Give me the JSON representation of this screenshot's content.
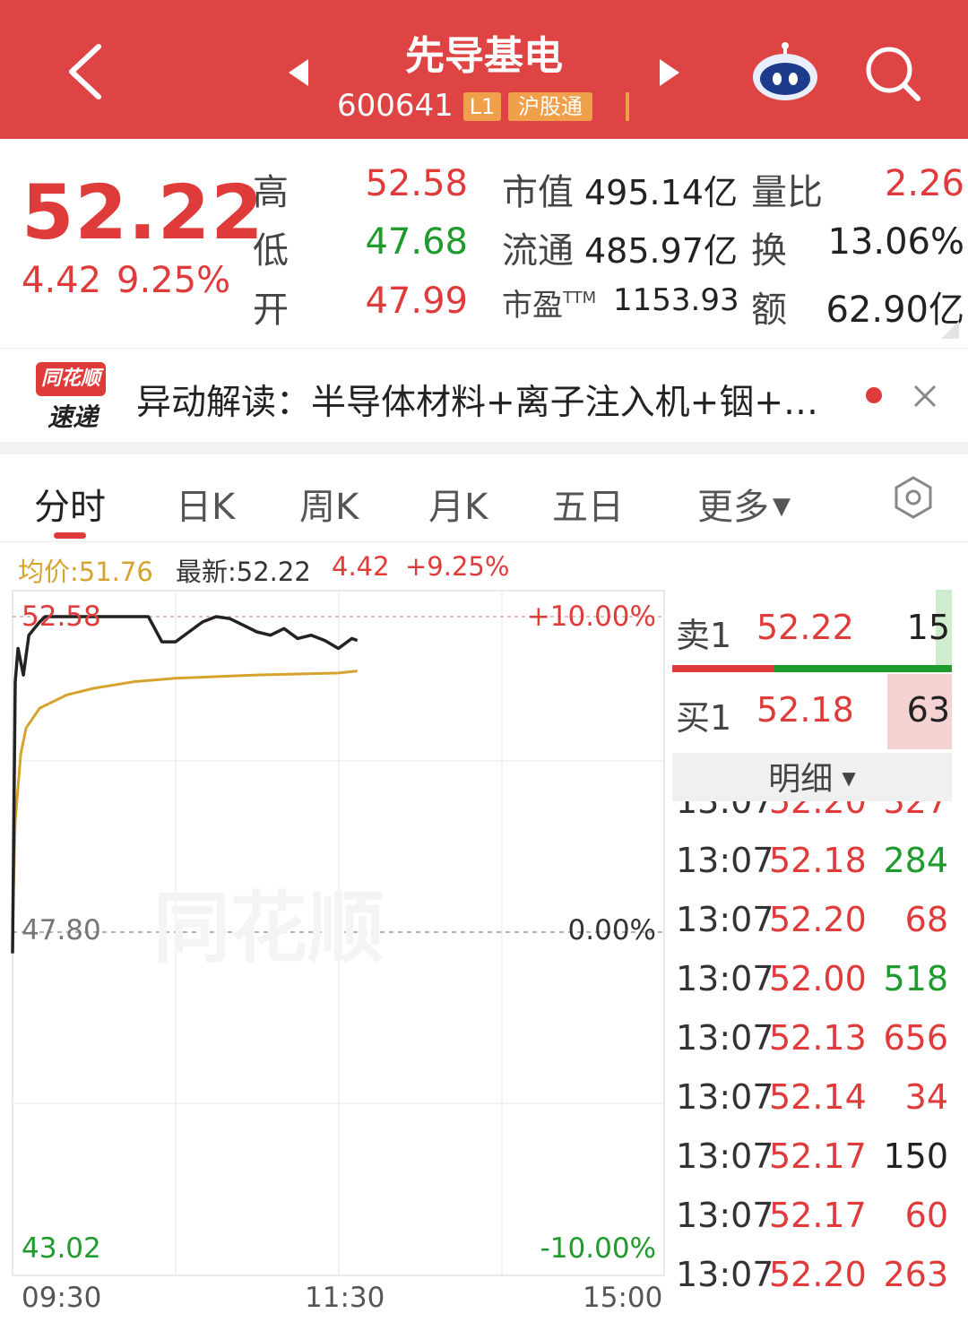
{
  "header": {
    "title": "先导基电",
    "code": "600641",
    "tag_l1": "L1",
    "tag_connect": "沪股通"
  },
  "quote": {
    "price": "52.22",
    "change": "4.42",
    "change_pct": "9.25%",
    "high_label": "高",
    "high": "52.58",
    "low_label": "低",
    "low": "47.68",
    "open_label": "开",
    "open": "47.99",
    "mktcap_label": "市值",
    "mktcap": "495.14亿",
    "float_label": "流通",
    "float": "485.97亿",
    "pe_label": "市盈",
    "pe_sup": "TTM",
    "pe": "1153.93",
    "volratio_label": "量比",
    "volratio": "2.26",
    "turnover_label": "换",
    "turnover": "13.06%",
    "amount_label": "额",
    "amount": "62.90亿"
  },
  "news": {
    "logo_top": "同花顺",
    "logo_bottom": "速递",
    "text": "异动解读：半导体材料+离子注入机+铟+…"
  },
  "tabs": [
    "分时",
    "日K",
    "周K",
    "月K",
    "五日",
    "更多"
  ],
  "chart_info": {
    "avg": "均价:51.76",
    "latest": "最新:52.22",
    "change": "4.42",
    "change_pct": "+9.25%"
  },
  "chart": {
    "y_top": "52.58",
    "y_mid": "47.80",
    "y_bottom": "43.02",
    "pct_top": "+10.00%",
    "pct_mid": "0.00%",
    "pct_bottom": "-10.00%",
    "x_start": "09:30",
    "x_mid": "11:30",
    "x_end": "15:00",
    "watermark": "同花顺"
  },
  "chart_data": {
    "type": "line",
    "x_range": [
      "09:30",
      "15:00"
    ],
    "ylim": [
      43.02,
      52.58
    ],
    "series": [
      {
        "name": "最新",
        "color": "#222222",
        "x": [
          "09:30",
          "09:31",
          "09:32",
          "09:34",
          "09:36",
          "09:38",
          "09:40",
          "09:42",
          "09:45",
          "09:50",
          "09:55",
          "10:00",
          "10:05",
          "10:10",
          "10:15",
          "10:20",
          "10:25",
          "10:30",
          "10:35",
          "10:40",
          "10:45",
          "10:50",
          "10:55",
          "11:00",
          "11:05",
          "11:10",
          "11:15",
          "11:20",
          "11:25",
          "13:00",
          "13:05",
          "13:07"
        ],
        "values": [
          47.5,
          51.6,
          52.1,
          51.7,
          52.3,
          52.4,
          52.5,
          52.58,
          52.58,
          52.58,
          52.58,
          52.58,
          52.58,
          52.58,
          52.58,
          52.58,
          52.2,
          52.2,
          52.35,
          52.5,
          52.58,
          52.55,
          52.45,
          52.35,
          52.3,
          52.4,
          52.25,
          52.3,
          52.22,
          52.1,
          52.25,
          52.22
        ]
      },
      {
        "name": "均价",
        "color": "#d6a32f",
        "x": [
          "09:30",
          "09:31",
          "09:33",
          "09:35",
          "09:40",
          "09:50",
          "10:00",
          "10:15",
          "10:30",
          "11:00",
          "11:30",
          "13:07"
        ],
        "values": [
          47.9,
          49.5,
          50.5,
          50.9,
          51.2,
          51.4,
          51.5,
          51.6,
          51.65,
          51.7,
          51.73,
          51.76
        ]
      }
    ]
  },
  "orderbook": {
    "sell1_label": "卖1",
    "sell1_price": "52.22",
    "sell1_vol": "15",
    "buy1_label": "买1",
    "buy1_price": "52.18",
    "buy1_vol": "63",
    "detail_label": "明细"
  },
  "trades": [
    {
      "time": "13:07",
      "price": "52.20",
      "vol": "327",
      "dir": "buy"
    },
    {
      "time": "13:07",
      "price": "52.18",
      "vol": "284",
      "dir": "sell"
    },
    {
      "time": "13:07",
      "price": "52.20",
      "vol": "68",
      "dir": "buy"
    },
    {
      "time": "13:07",
      "price": "52.00",
      "vol": "518",
      "dir": "sell"
    },
    {
      "time": "13:07",
      "price": "52.13",
      "vol": "656",
      "dir": "buy"
    },
    {
      "time": "13:07",
      "price": "52.14",
      "vol": "34",
      "dir": "buy"
    },
    {
      "time": "13:07",
      "price": "52.17",
      "vol": "150",
      "dir": "neutral"
    },
    {
      "time": "13:07",
      "price": "52.17",
      "vol": "60",
      "dir": "buy"
    },
    {
      "time": "13:07",
      "price": "52.20",
      "vol": "263",
      "dir": "buy"
    }
  ],
  "colors": {
    "brand_red": "#df4444",
    "up": "#e03b3b",
    "down": "#1f9a2c",
    "avg_line": "#d6a32f",
    "tag_orange": "#f0a04a"
  }
}
